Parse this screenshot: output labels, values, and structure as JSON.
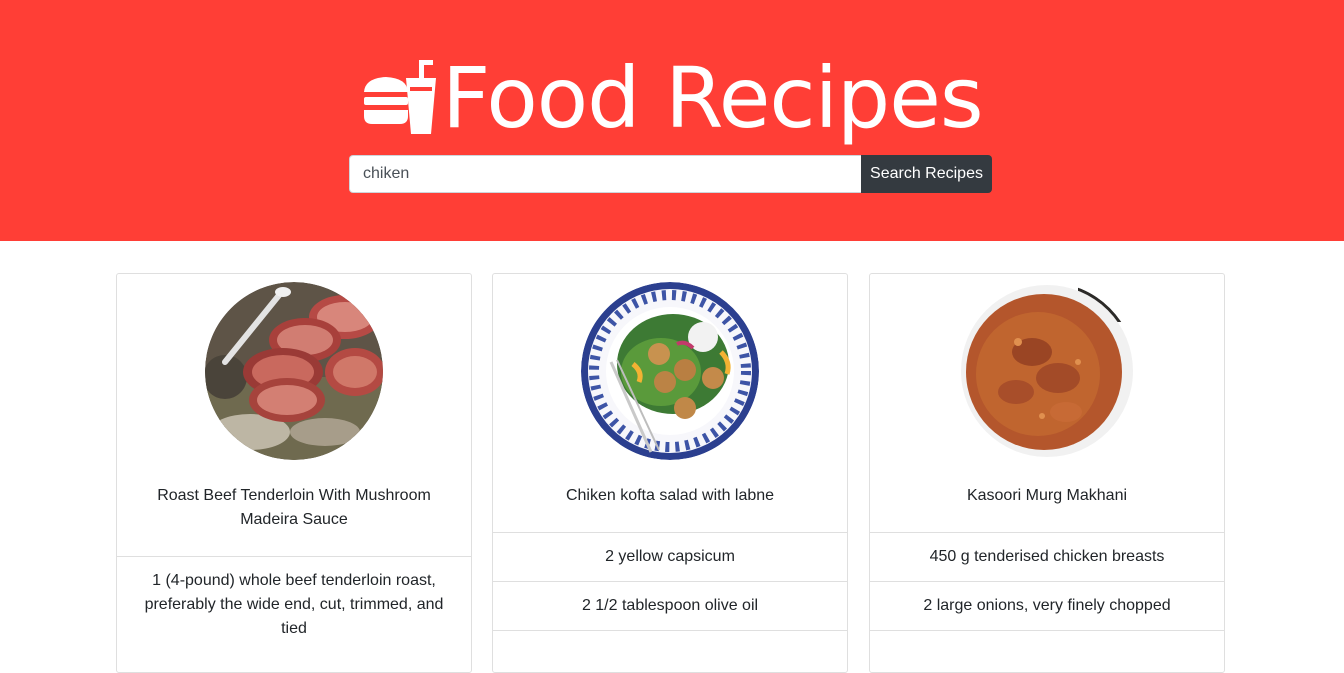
{
  "header": {
    "title": "Food Recipes",
    "icon": "burger-and-drink-icon",
    "background_color": "#ff3e36"
  },
  "search": {
    "value": "chiken",
    "placeholder": "",
    "button_label": "Search Recipes"
  },
  "recipes": [
    {
      "title": "Roast Beef Tenderloin With Mushroom Madeira Sauce",
      "image": "roast-beef-photo",
      "ingredients": [
        "1 (4-pound) whole beef tenderloin roast, preferably the wide end, cut, trimmed, and tied"
      ]
    },
    {
      "title": "Chiken kofta salad with labne",
      "image": "kofta-salad-photo",
      "ingredients": [
        "2 yellow capsicum",
        "2 1/2 tablespoon olive oil"
      ]
    },
    {
      "title": "Kasoori Murg Makhani",
      "image": "murg-makhani-photo",
      "ingredients": [
        "450 g tenderised chicken breasts",
        "2 large onions, very finely chopped"
      ]
    }
  ]
}
